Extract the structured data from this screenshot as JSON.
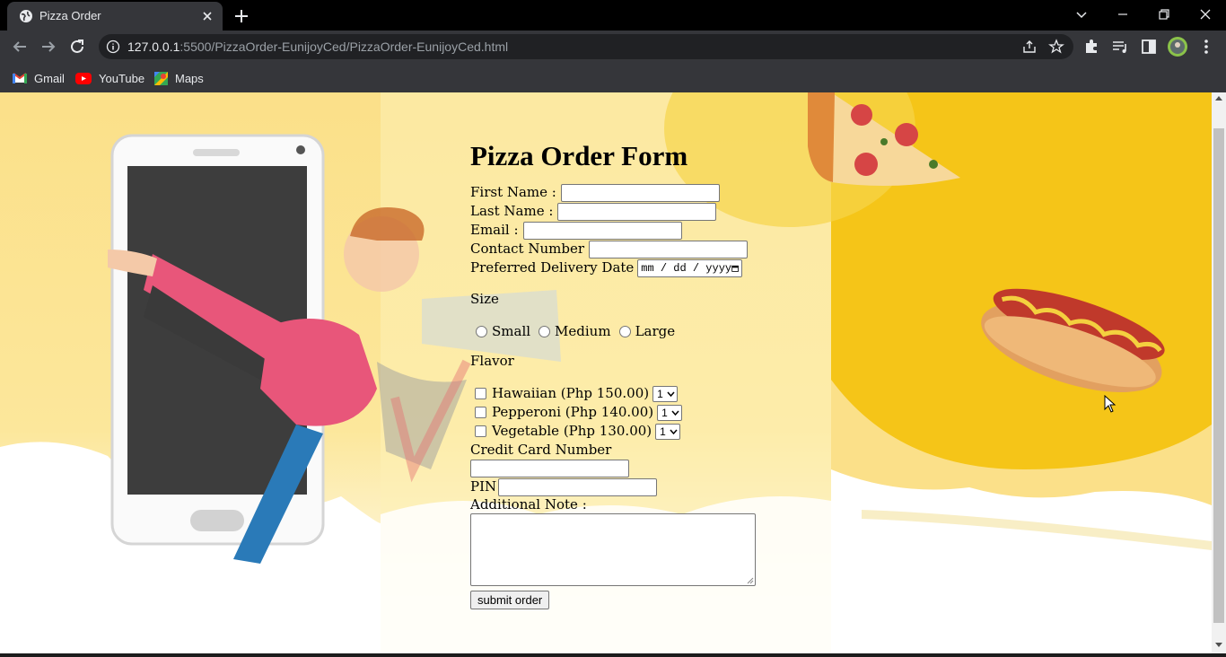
{
  "browser": {
    "tab_title": "Pizza Order",
    "url_host": "127.0.0.1",
    "url_rest": ":5500/PizzaOrder-EunijoyCed/PizzaOrder-EunijoyCed.html",
    "bookmarks": [
      {
        "label": "Gmail",
        "icon": "gmail-icon"
      },
      {
        "label": "YouTube",
        "icon": "youtube-icon"
      },
      {
        "label": "Maps",
        "icon": "maps-icon"
      }
    ]
  },
  "form": {
    "title": "Pizza Order Form",
    "first_name_label": "First Name :",
    "last_name_label": "Last Name :",
    "email_label": "Email :",
    "contact_label": "Contact Number",
    "date_label": "Preferred Delivery Date",
    "date_placeholder": "mm / dd / yyyy",
    "size_label": "Size",
    "sizes": [
      "Small",
      "Medium",
      "Large"
    ],
    "flavor_label": "Flavor",
    "flavors": [
      {
        "label": "Hawaiian (Php 150.00)",
        "qty": "1"
      },
      {
        "label": "Pepperoni (Php 140.00)",
        "qty": "1"
      },
      {
        "label": "Vegetable (Php 130.00)",
        "qty": "1"
      }
    ],
    "credit_card_label": "Credit Card Number",
    "pin_label": "PIN",
    "note_label": "Additional Note :",
    "submit_label": "submit order"
  },
  "colors": {
    "chrome_dark": "#202124",
    "chrome_tab": "#35363a",
    "page_yellow": "#fbe089",
    "accent_yellow": "#f5c518"
  }
}
